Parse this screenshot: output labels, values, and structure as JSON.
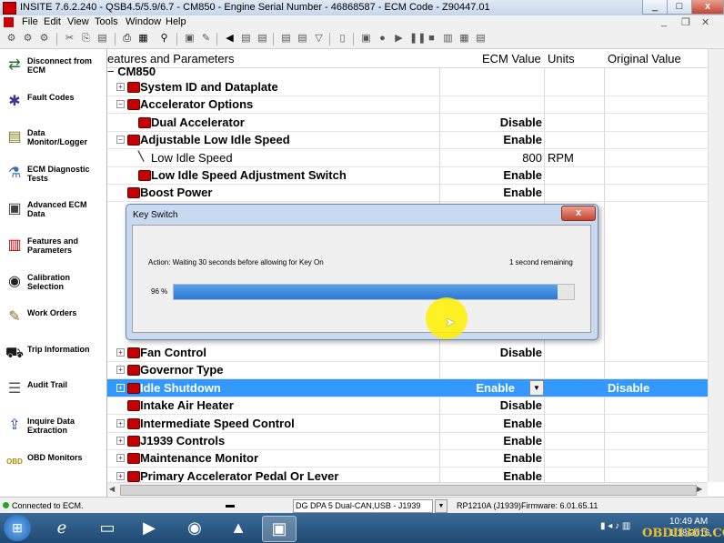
{
  "window": {
    "title": "INSITE 7.6.2.240  -  QSB4.5/5.9/6.7 - CM850 - Engine Serial Number - 46868587 - ECM Code - Z90447.01",
    "controls": [
      "_",
      "□",
      "x"
    ]
  },
  "menu": [
    "File",
    "Edit",
    "View",
    "Tools",
    "Window",
    "Help"
  ],
  "sidebar": [
    {
      "label": "Disconnect from ECM",
      "icon": "disconnect-icon",
      "color": "#2a6e2a",
      "glyph": "⇄"
    },
    {
      "label": "Fault Codes",
      "icon": "fault-codes-icon",
      "color": "#3a3a8a",
      "glyph": "✱"
    },
    {
      "label": "Data Monitor/Logger",
      "icon": "data-monitor-icon",
      "color": "#8a7a20",
      "glyph": "▤"
    },
    {
      "label": "ECM Diagnostic Tests",
      "icon": "diagnostic-tests-icon",
      "color": "#3a6ea8",
      "glyph": "⚗"
    },
    {
      "label": "Advanced ECM Data",
      "icon": "advanced-ecm-data-icon",
      "color": "#404040",
      "glyph": "▣"
    },
    {
      "label": "Features and Parameters",
      "icon": "features-parameters-icon",
      "color": "#c40000",
      "glyph": "▥"
    },
    {
      "label": "Calibration Selection",
      "icon": "calibration-icon",
      "color": "#222222",
      "glyph": "◉"
    },
    {
      "label": "Work Orders",
      "icon": "work-orders-icon",
      "color": "#8a6a20",
      "glyph": "✎"
    },
    {
      "label": "Trip Information",
      "icon": "trip-info-icon",
      "color": "#1a1a1a",
      "glyph": "⛟"
    },
    {
      "label": "Audit Trail",
      "icon": "audit-trail-icon",
      "color": "#505050",
      "glyph": "☰"
    },
    {
      "label": "Inquire Data Extraction",
      "icon": "inquire-data-icon",
      "color": "#2050a0",
      "glyph": "⇪"
    },
    {
      "label": "OBD Monitors",
      "icon": "obd-monitors-icon",
      "color": "#b08a00",
      "glyph": "OBD"
    }
  ],
  "grid": {
    "headers": {
      "feature": "eatures and Parameters",
      "ecm_value": "ECM Value",
      "units": "Units",
      "original": "Original Value"
    },
    "root": "CM850",
    "rows": [
      {
        "name": "System ID and Dataplate",
        "value": "",
        "unit": "",
        "orig": "",
        "indent": 0,
        "expander": "+"
      },
      {
        "name": "Accelerator Options",
        "value": "",
        "unit": "",
        "orig": "",
        "indent": 0,
        "expander": "−"
      },
      {
        "name": "Dual Accelerator",
        "value": "Disable",
        "unit": "",
        "orig": "",
        "indent": 1,
        "expander": ""
      },
      {
        "name": "Adjustable Low Idle Speed",
        "value": "Enable",
        "unit": "",
        "orig": "",
        "indent": 0,
        "expander": "−"
      },
      {
        "name": "Low Idle Speed",
        "value": "800",
        "unit": "RPM",
        "orig": "",
        "indent": 1,
        "expander": "",
        "plain": true
      },
      {
        "name": "Low Idle Speed Adjustment Switch",
        "value": "Enable",
        "unit": "",
        "orig": "",
        "indent": 1,
        "expander": ""
      },
      {
        "name": "Boost Power",
        "value": "Enable",
        "unit": "",
        "orig": "",
        "indent": 0,
        "expander": ""
      }
    ],
    "rows_bottom": [
      {
        "name": "Fan Control",
        "value": "Disable",
        "unit": "",
        "orig": "",
        "indent": 0,
        "expander": "+"
      },
      {
        "name": "Governor Type",
        "value": "",
        "unit": "",
        "orig": "",
        "indent": 0,
        "expander": "+"
      },
      {
        "name": "Idle Shutdown",
        "value": "Enable",
        "unit": "",
        "orig": "Disable",
        "indent": 0,
        "expander": "+",
        "selected": true
      },
      {
        "name": "Intake Air Heater",
        "value": "Disable",
        "unit": "",
        "orig": "",
        "indent": 0,
        "expander": ""
      },
      {
        "name": "Intermediate Speed Control",
        "value": "Enable",
        "unit": "",
        "orig": "",
        "indent": 0,
        "expander": "+"
      },
      {
        "name": "J1939 Controls",
        "value": "Enable",
        "unit": "",
        "orig": "",
        "indent": 0,
        "expander": "+"
      },
      {
        "name": "Maintenance Monitor",
        "value": "Enable",
        "unit": "",
        "orig": "",
        "indent": 0,
        "expander": "+"
      },
      {
        "name": "Primary Accelerator Pedal Or Lever",
        "value": "Enable",
        "unit": "",
        "orig": "",
        "indent": 0,
        "expander": "+"
      }
    ]
  },
  "dialog": {
    "title": "Key Switch",
    "close": "x",
    "action": "Action: Waiting 30 seconds before allowing for Key On",
    "remaining": "1 second remaining",
    "percent_label": "96 %",
    "progress": 0.96
  },
  "status": {
    "connection": "Connected to ECM.",
    "adapter": "DG DPA 5 Dual-CAN,USB - J1939",
    "protocol": "RP1210A (J1939)",
    "firmware": "Firmware: 6.01.65.11"
  },
  "taskbar": {
    "time": "10:49 AM",
    "date": "1/18/2016",
    "watermark": "OBDII365.COM"
  },
  "colors": {
    "selection": "#3399ff",
    "progress": "#2a78d6",
    "title_bg": "#c6d6ea"
  }
}
